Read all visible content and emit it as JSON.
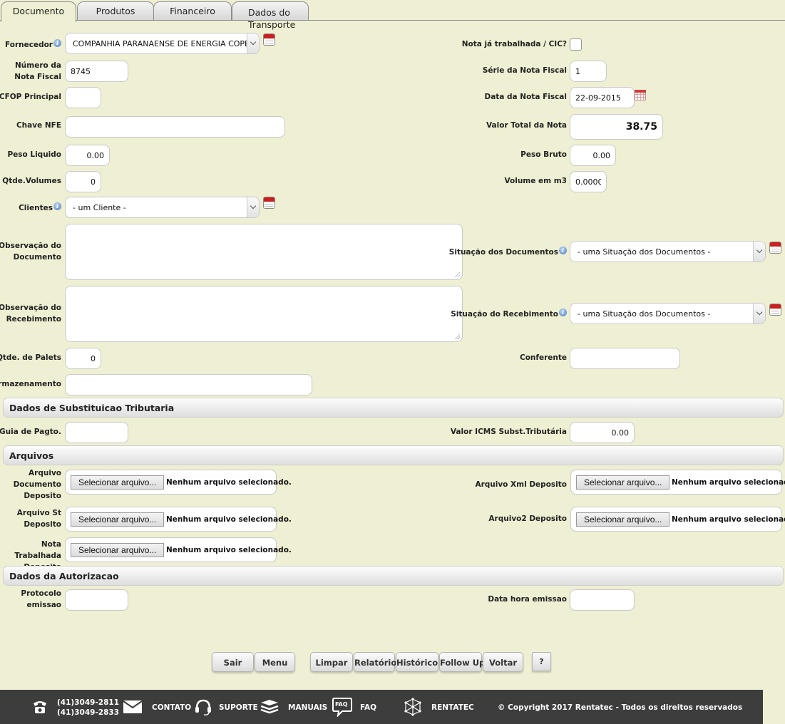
{
  "tabs": [
    {
      "label": "Documento"
    },
    {
      "label": "Produtos"
    },
    {
      "label": "Financeiro"
    },
    {
      "label": "Dados do Transporte"
    }
  ],
  "form": {
    "fornecedor_label": "Fornecedor",
    "fornecedor_value": "COMPANHIA PARANAENSE DE ENERGIA COPEL -",
    "nota_trabalhada_label": "Nota já trabalhada / CIC?",
    "numero_nf_label": "Número da Nota Fiscal",
    "numero_nf_value": "8745",
    "serie_nf_label": "Série da Nota Fiscal",
    "serie_nf_value": "1",
    "cfop_label": "CFOP Principal",
    "cfop_value": "",
    "data_nf_label": "Data da Nota Fiscal",
    "data_nf_value": "22-09-2015",
    "chave_nfe_label": "Chave NFE",
    "chave_nfe_value": "",
    "valor_total_label": "Valor Total da Nota",
    "valor_total_value": "38.75",
    "peso_liquido_label": "Peso Liquido",
    "peso_liquido_value": "0.00",
    "peso_bruto_label": "Peso Bruto",
    "peso_bruto_value": "0.00",
    "qtde_volumes_label": "Qtde.Volumes",
    "qtde_volumes_value": "0",
    "volume_m3_label": "Volume em m3",
    "volume_m3_value": "0.0000",
    "clientes_label": "Clientes",
    "clientes_value": "- um Cliente -",
    "obs_documento_label": "Observação do Documento",
    "obs_documento_value": "",
    "situacao_documentos_label": "Situação dos Documentos",
    "situacao_documentos_value": "- uma Situação dos Documentos -",
    "obs_recebimento_label": "Observação do Recebimento",
    "obs_recebimento_value": "",
    "situacao_recebimento_label": "Situação do Recebimento",
    "situacao_recebimento_value": "- uma Situação dos Documentos -",
    "qtde_palets_label": "Qtde. de Palets",
    "qtde_palets_value": "0",
    "conferente_label": "Conferente",
    "conferente_value": "",
    "armazenamento_label": "Armazenamento",
    "armazenamento_value": ""
  },
  "substituicao": {
    "title": "Dados de Substituicao Tributaria",
    "guia_label": "Guia de Pagto.",
    "guia_value": "",
    "valor_icms_label": "Valor ICMS Subst.Tributária",
    "valor_icms_value": "0.00"
  },
  "arquivos": {
    "title": "Arquivos",
    "button_label": "Selecionar arquivo...",
    "status_text": "Nenhum arquivo selecionado.",
    "arquivo_documento_label": "Arquivo Documento Deposito",
    "arquivo_xml_label": "Arquivo Xml Deposito",
    "arquivo_st_label": "Arquivo St Deposito",
    "arquivo2_label": "Arquivo2 Deposito",
    "nota_trabalhada_label": "Nota Trabalhada Deposito"
  },
  "autorizacao": {
    "title": "Dados da Autorizacao",
    "protocolo_label": "Protocolo emissao",
    "protocolo_value": "",
    "data_hora_label": "Data hora emissao",
    "data_hora_value": ""
  },
  "buttons": {
    "sair": "Sair",
    "menu": "Menu",
    "limpar": "Limpar",
    "relatorio": "Relatório",
    "historico": "Histórico",
    "follow_up": "Follow Up",
    "voltar": "Voltar",
    "help": "?"
  },
  "footer": {
    "phone1": "(41)3049-2811",
    "phone2": "(41)3049-2833",
    "contato": "CONTATO",
    "suporte": "SUPORTE",
    "manuais": "MANUAIS",
    "faq_badge": "FAQ",
    "faq": "FAQ",
    "rentatec": "RENTATEC",
    "copyright": "© Copyright 2017 Rentatec - Todos os direitos reservados"
  },
  "icons": {
    "info": "info-icon",
    "picker": "list-picker-icon",
    "calendar": "calendar-icon",
    "phone": "phone-icon",
    "mail": "envelope-icon",
    "support": "headset-icon",
    "manuals": "books-icon",
    "faq": "faq-bubble-icon",
    "rentatec": "network-logo-icon"
  },
  "colors": {
    "page_background": "#efefd3",
    "footer_background": "#3d3d3d"
  }
}
